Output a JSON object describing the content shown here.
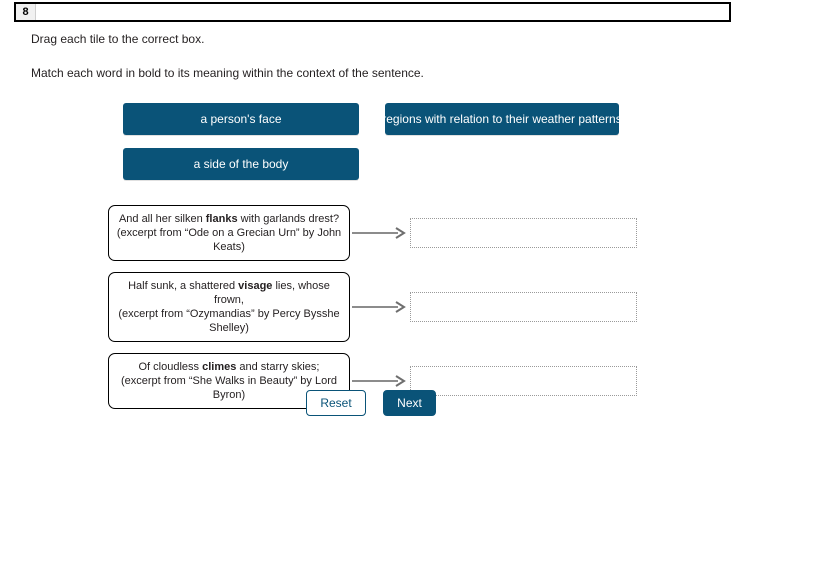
{
  "question_bar": {
    "number": "8"
  },
  "instructions": {
    "line1": "Drag each tile to the correct box.",
    "line2": "Match each word in bold to its meaning within the context of the sentence."
  },
  "tiles": [
    {
      "label": "a person's face"
    },
    {
      "label": "regions with relation to their weather patterns"
    },
    {
      "label": "a side of the body"
    }
  ],
  "matches": [
    {
      "sentence_pre": "And all her silken ",
      "sentence_bold": "flanks",
      "sentence_post": " with garlands drest?",
      "source": "(excerpt from “Ode on a Grecian Urn” by John Keats)",
      "answer": ""
    },
    {
      "sentence_pre": "Half sunk, a shattered ",
      "sentence_bold": "visage",
      "sentence_post": " lies, whose frown,",
      "source": "(excerpt from “Ozymandias” by Percy Bysshe Shelley)",
      "answer": ""
    },
    {
      "sentence_pre": "Of cloudless ",
      "sentence_bold": "climes",
      "sentence_post": " and starry skies;",
      "source": "(excerpt from “She Walks in Beauty” by Lord Byron)",
      "answer": ""
    }
  ],
  "buttons": {
    "reset": "Reset",
    "next": "Next"
  },
  "colors": {
    "accent": "#0a5378",
    "tile_text": "#ffffff",
    "text": "#231f20",
    "dropzone_border": "#9a9a9a",
    "arrow": "#8c8c8c"
  }
}
